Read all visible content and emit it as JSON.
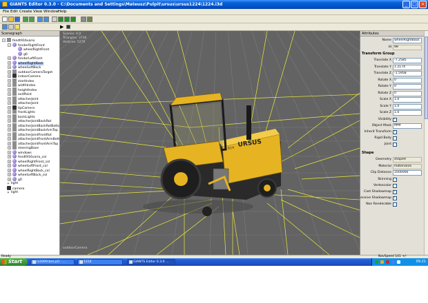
{
  "window": {
    "title": "GIANTS Editor 0.3.0 - C:\\Documents and Settings\\Mateusz\\Pulpit\\ursus\\ursus1224\\1224.i3d"
  },
  "menu": [
    "File",
    "Edit",
    "Create",
    "View",
    "Window",
    "Help"
  ],
  "toolbar_icons": [
    "new-icon",
    "open-icon",
    "save-icon",
    "import-icon",
    "export-icon",
    "undo-icon",
    "redo-icon",
    "select-icon",
    "move-icon",
    "rotate-icon",
    "scale-icon",
    "settings-icon",
    "terrain-icon"
  ],
  "toolbar2_icons": [
    "camera-icon",
    "grid-icon",
    "light-icon",
    "play-icon",
    "stop-icon"
  ],
  "scenegraph": {
    "title": "Scenegraph",
    "nodes": [
      {
        "label": "fendt916vario",
        "depth": 0,
        "icon": "tg"
      },
      {
        "label": "fenderRightFront",
        "depth": 1,
        "icon": "mesh"
      },
      {
        "label": "wheelRightFront",
        "depth": 2,
        "icon": "mesh"
      },
      {
        "label": "g0",
        "depth": 2,
        "icon": "mesh"
      },
      {
        "label": "fenderLeftFront",
        "depth": 1,
        "icon": "mesh"
      },
      {
        "label": "wheelRightBack",
        "depth": 1,
        "icon": "mesh",
        "selected": true
      },
      {
        "label": "wheelLeftBack",
        "depth": 1,
        "icon": "mesh"
      },
      {
        "label": "outdoorCameraTarget",
        "depth": 1,
        "icon": "tg"
      },
      {
        "label": "indoorCamera",
        "depth": 1,
        "icon": "cam"
      },
      {
        "label": "startIndex",
        "depth": 1,
        "icon": "tg"
      },
      {
        "label": "widthIndex",
        "depth": 1,
        "icon": "tg"
      },
      {
        "label": "heightIndex",
        "depth": 1,
        "icon": "tg"
      },
      {
        "label": "exitPoint",
        "depth": 1,
        "icon": "tg"
      },
      {
        "label": "attacherJoint",
        "depth": 1,
        "icon": "tg"
      },
      {
        "label": "attacherJoint",
        "depth": 1,
        "icon": "tg"
      },
      {
        "label": "tipCamera",
        "depth": 1,
        "icon": "cam"
      },
      {
        "label": "frontLights",
        "depth": 1,
        "icon": "tg"
      },
      {
        "label": "backLights",
        "depth": 1,
        "icon": "tg"
      },
      {
        "label": "attacherJointBackRot",
        "depth": 1,
        "icon": "tg"
      },
      {
        "label": "attacherJointBackRotBottom",
        "depth": 1,
        "icon": "tg"
      },
      {
        "label": "attacherJointBackArmTop",
        "depth": 1,
        "icon": "tg"
      },
      {
        "label": "attacherJointFrontRot",
        "depth": 1,
        "icon": "tg"
      },
      {
        "label": "attacherJointFrontArmBottom",
        "depth": 1,
        "icon": "tg"
      },
      {
        "label": "attacherJointFrontArmTop",
        "depth": 1,
        "icon": "tg"
      },
      {
        "label": "steeringBase",
        "depth": 1,
        "icon": "tg"
      },
      {
        "label": "windows",
        "depth": 1,
        "icon": "mesh"
      },
      {
        "label": "fendt916vario_col",
        "depth": 1,
        "icon": "mesh"
      },
      {
        "label": "wheelRightFront_col",
        "depth": 1,
        "icon": "mesh"
      },
      {
        "label": "wheelLeftFront_col",
        "depth": 1,
        "icon": "mesh"
      },
      {
        "label": "wheelRightBack_col",
        "depth": 1,
        "icon": "mesh"
      },
      {
        "label": "wheelLeftBack_col",
        "depth": 1,
        "icon": "mesh"
      },
      {
        "label": "g0",
        "depth": 1,
        "icon": "mesh"
      },
      {
        "label": "light",
        "depth": 0,
        "icon": "light"
      },
      {
        "label": "camera",
        "depth": 0,
        "icon": "cam"
      },
      {
        "label": "light",
        "depth": 0,
        "icon": "light"
      }
    ]
  },
  "viewport": {
    "stats": [
      "Scenes: 4.0",
      "Triangles: 3730",
      "Vertices: 5270"
    ],
    "camera_label": "outdoorCamera",
    "hood_text": "URSUS",
    "model_number": "914"
  },
  "attributes": {
    "title": "Attributes",
    "name_label": "Name",
    "name_value": "wheelRightBack",
    "id_label": "Id",
    "id_value": "99",
    "transform_title": "Transform Group",
    "transform": [
      {
        "label": "Translate X",
        "value": "-7.2585"
      },
      {
        "label": "Translate Y",
        "value": "1.2174"
      },
      {
        "label": "Translate Z",
        "value": "-1.5958"
      },
      {
        "label": "Rotate X",
        "value": "0"
      },
      {
        "label": "Rotate Y",
        "value": "0"
      },
      {
        "label": "Rotate Z",
        "value": "0"
      },
      {
        "label": "Scale X",
        "value": "1.0"
      },
      {
        "label": "Scale Y",
        "value": "1.0"
      },
      {
        "label": "Scale Z",
        "value": "1.0"
      }
    ],
    "flags1": [
      {
        "label": "Visibility",
        "checked": true
      }
    ],
    "object_mask_label": "Object Mask",
    "object_mask_value": "ffffff",
    "flags2": [
      {
        "label": "Inherit Transform",
        "checked": true
      },
      {
        "label": "Rigid Body",
        "checked": false
      },
      {
        "label": "Joint",
        "checked": false
      }
    ],
    "shape_title": "Shape",
    "geometry_label": "Geometry",
    "geometry_value": "shape9",
    "material_label": "Material",
    "material_value": "material16",
    "clip_label": "Clip Distance",
    "clip_value": "1000000",
    "flags3": [
      {
        "label": "Skinning",
        "checked": false
      },
      {
        "label": "Vertexcolor",
        "checked": false
      },
      {
        "label": "Cast Shadowmap",
        "checked": true
      },
      {
        "label": "Receive Shadowmap",
        "checked": true
      },
      {
        "label": "Non Renderable",
        "checked": false
      }
    ]
  },
  "status": {
    "left": "Ready",
    "nav_speed": "NavSpeed 141 +/-"
  },
  "taskbar": {
    "start_label": "Start",
    "tasks": [
      {
        "label": "[s2009.bez.pl] - ..."
      },
      {
        "label": "1224"
      },
      {
        "label": "GIANTS Editor 0.3.0 ...",
        "active": true
      }
    ],
    "clock": "09:21",
    "tray_colors": [
      "#2b9b2b",
      "#e0b020",
      "#c03030",
      "#4080f0",
      "#ffffff"
    ]
  },
  "colors": {
    "tractor_yellow": "#e6b422",
    "gizmo_lines": "#ecec3c",
    "viewport_bg": "#636363",
    "selection": "#b4c8f0"
  }
}
